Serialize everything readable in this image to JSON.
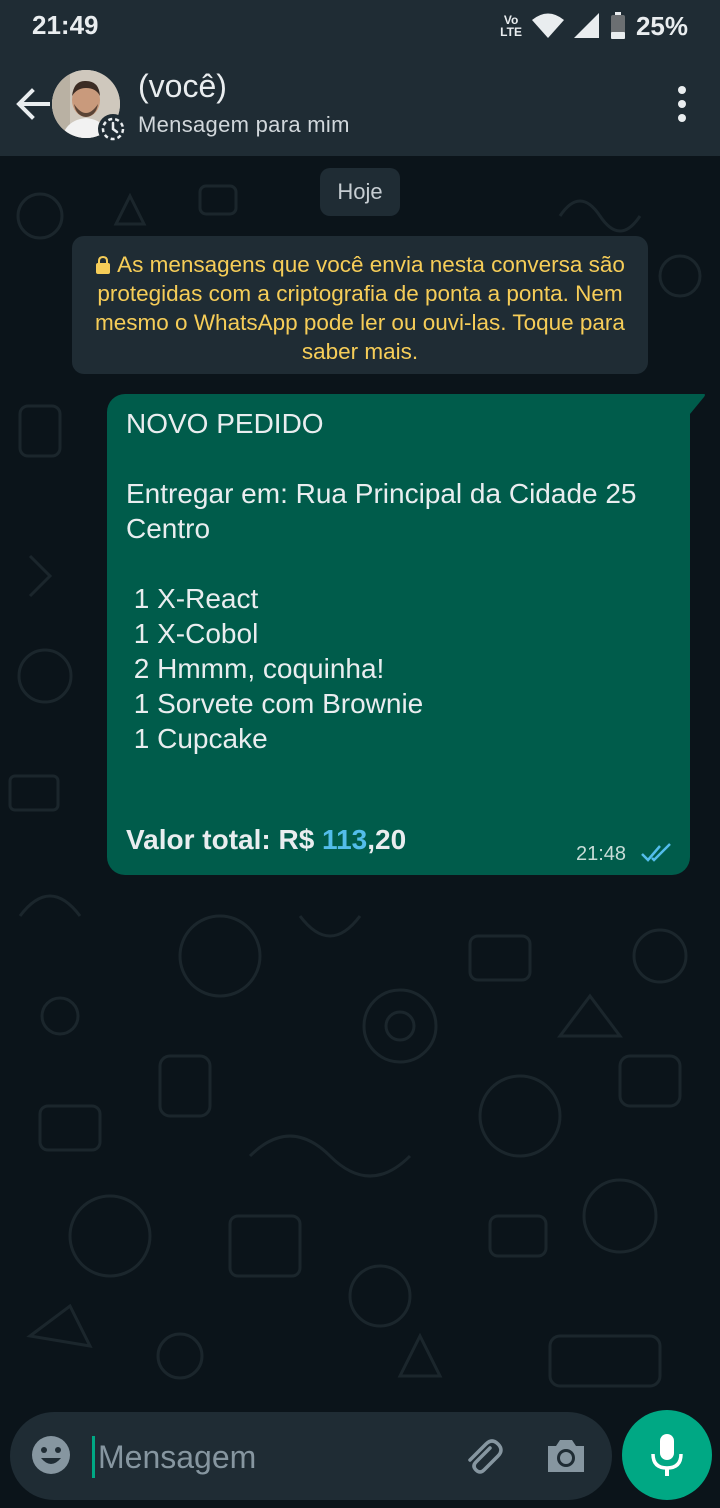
{
  "status_bar": {
    "time": "21:49",
    "volte_top": "Vo",
    "volte_bottom": "LTE",
    "battery": "25%"
  },
  "header": {
    "contact_name": "(você)",
    "subtitle": "Mensagem para mim"
  },
  "chat": {
    "date_chip": "Hoje",
    "encryption_notice": "As mensagens que você envia nesta conversa são protegidas com a criptografia de ponta a ponta. Nem mesmo o WhatsApp pode ler ou ouvi-las. Toque para saber mais.",
    "message": {
      "text": "NOVO PEDIDO\n\nEntregar em: Rua Principal da Cidade 25\nCentro\n\n 1 X-React\n 1 X-Cobol\n 2 Hmmm, coquinha!\n 1 Sorvete com Brownie\n 1 Cupcake",
      "total_label": "Valor total: R$ ",
      "total_integer": "113",
      "total_decimal": ",20",
      "time": "21:48"
    }
  },
  "composer": {
    "placeholder": "Mensagem"
  },
  "colors": {
    "header_bg": "#1f2c34",
    "chat_bg": "#0b141a",
    "outgoing_bubble": "#005c4b",
    "accent": "#00a884",
    "link_blue": "#53bdeb",
    "notice_yellow": "#f6cd58"
  },
  "icons": [
    "back-arrow-icon",
    "status-ring-icon",
    "more-vert-icon",
    "lock-icon",
    "double-check-icon",
    "emoji-icon",
    "attach-icon",
    "camera-icon",
    "mic-icon"
  ]
}
